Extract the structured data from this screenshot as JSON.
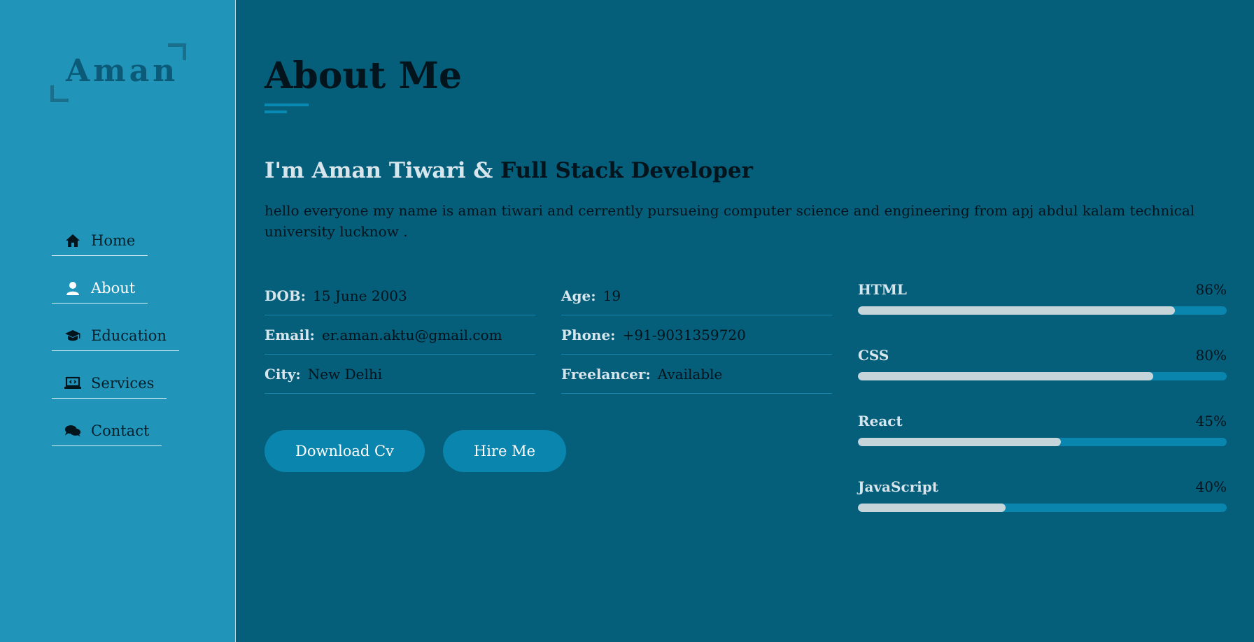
{
  "sidebar": {
    "logo": "Aman",
    "items": [
      {
        "label": "Home",
        "icon": "home-icon"
      },
      {
        "label": "About",
        "icon": "user-icon",
        "active": true
      },
      {
        "label": "Education",
        "icon": "graduation-cap-icon"
      },
      {
        "label": "Services",
        "icon": "laptop-code-icon"
      },
      {
        "label": "Contact",
        "icon": "comments-icon"
      }
    ]
  },
  "main": {
    "title": "About Me",
    "intro": {
      "heading_prefix": "I'm Aman Tiwari & ",
      "heading_role": "Full Stack Developer",
      "text": "hello everyone my name is aman tiwari and cerrently pursueing computer science and engineering from apj abdul kalam technical university lucknow ."
    },
    "info": [
      {
        "label": "DOB:",
        "value": "15 June 2003"
      },
      {
        "label": "Age:",
        "value": "19"
      },
      {
        "label": "Email:",
        "value": "er.aman.aktu@gmail.com"
      },
      {
        "label": "Phone:",
        "value": "+91-9031359720"
      },
      {
        "label": "City:",
        "value": "New Delhi"
      },
      {
        "label": "Freelancer:",
        "value": "Available"
      }
    ],
    "buttons": {
      "download": "Download Cv",
      "hire": "Hire Me"
    },
    "skills": [
      {
        "name": "HTML",
        "percent": "86%",
        "level": 86
      },
      {
        "name": "CSS",
        "percent": "80%",
        "level": 80
      },
      {
        "name": "React",
        "percent": "45%",
        "level": 55
      },
      {
        "name": "JavaScript",
        "percent": "40%",
        "level": 40
      }
    ]
  },
  "colors": {
    "sidebar_bg": "#2194b9",
    "main_bg": "#055e7a",
    "accent": "#0a85ad",
    "bar_fill": "#c6d5da"
  }
}
